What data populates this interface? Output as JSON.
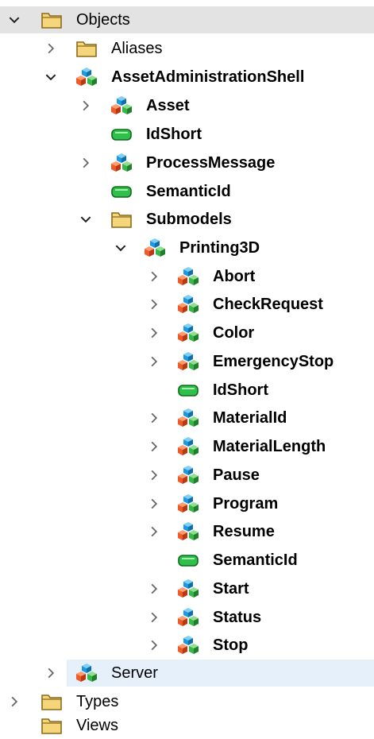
{
  "tree": {
    "objects": {
      "label": "Objects",
      "icon": "folder-icon",
      "expanded": true
    },
    "aliases": {
      "label": "Aliases",
      "icon": "folder-icon",
      "expanded": false
    },
    "aas": {
      "label": "AssetAdministrationShell",
      "icon": "object-icon",
      "expanded": true
    },
    "asset": {
      "label": "Asset",
      "icon": "object-icon",
      "expanded": false
    },
    "aas_idshort": {
      "label": "IdShort",
      "icon": "variable-icon"
    },
    "process_message": {
      "label": "ProcessMessage",
      "icon": "object-icon",
      "expanded": false
    },
    "aas_semanticid": {
      "label": "SemanticId",
      "icon": "variable-icon"
    },
    "submodels": {
      "label": "Submodels",
      "icon": "folder-icon",
      "expanded": true
    },
    "printing3d": {
      "label": "Printing3D",
      "icon": "object-icon",
      "expanded": true
    },
    "abort": {
      "label": "Abort",
      "icon": "object-icon",
      "expanded": false
    },
    "check_request": {
      "label": "CheckRequest",
      "icon": "object-icon",
      "expanded": false
    },
    "color": {
      "label": "Color",
      "icon": "object-icon",
      "expanded": false
    },
    "emergency_stop": {
      "label": "EmergencyStop",
      "icon": "object-icon",
      "expanded": false
    },
    "p_idshort": {
      "label": "IdShort",
      "icon": "variable-icon"
    },
    "material_id": {
      "label": "MaterialId",
      "icon": "object-icon",
      "expanded": false
    },
    "material_length": {
      "label": "MaterialLength",
      "icon": "object-icon",
      "expanded": false
    },
    "pause": {
      "label": "Pause",
      "icon": "object-icon",
      "expanded": false
    },
    "program": {
      "label": "Program",
      "icon": "object-icon",
      "expanded": false
    },
    "resume": {
      "label": "Resume",
      "icon": "object-icon",
      "expanded": false
    },
    "p_semanticid": {
      "label": "SemanticId",
      "icon": "variable-icon"
    },
    "start": {
      "label": "Start",
      "icon": "object-icon",
      "expanded": false
    },
    "status": {
      "label": "Status",
      "icon": "object-icon",
      "expanded": false
    },
    "stop": {
      "label": "Stop",
      "icon": "object-icon",
      "expanded": false
    },
    "server": {
      "label": "Server",
      "icon": "object-icon",
      "expanded": false,
      "selected": true
    },
    "types": {
      "label": "Types",
      "icon": "folder-icon",
      "expanded": false
    },
    "views": {
      "label": "Views",
      "icon": "folder-icon"
    }
  },
  "colors": {
    "folder_fill": "#f5d67a",
    "folder_stroke": "#8a6a1c",
    "variable_fill": "#2fbf4a",
    "object_red": "#ef5a2a",
    "object_blue": "#1a9ae0",
    "object_green": "#3bb54a",
    "hover_bg": "#e3e3e3",
    "selected_bg": "#e5f0fb"
  }
}
